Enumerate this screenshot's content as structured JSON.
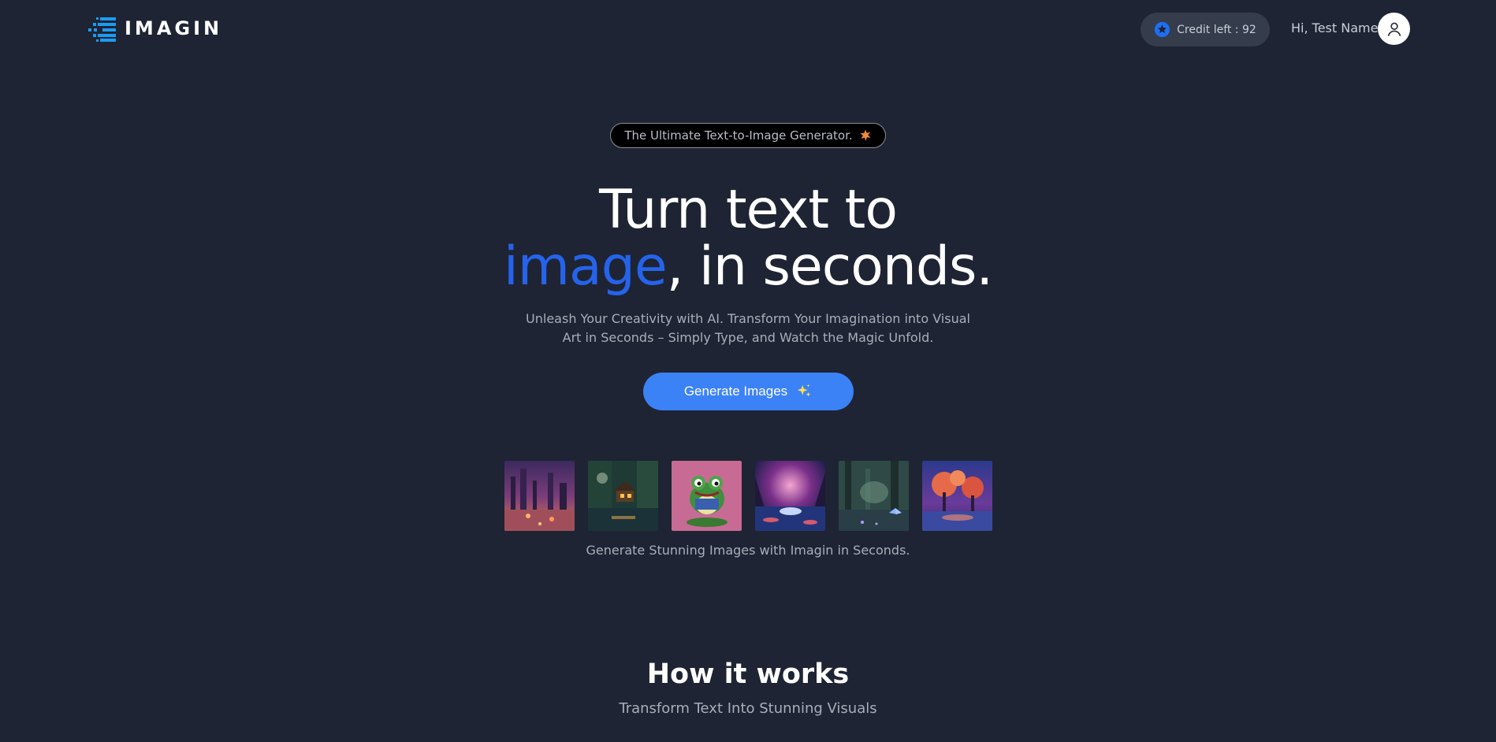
{
  "header": {
    "logo_text": "IMAGIN",
    "credits_label": "Credit left : 92",
    "greeting": "Hi, Test Name"
  },
  "hero": {
    "tagline": "The Ultimate Text-to-Image Generator.",
    "headline_line1": "Turn text to",
    "headline_accent": "image",
    "headline_rest": ", in seconds.",
    "subtitle": "Unleash Your Creativity with AI. Transform Your Imagination into Visual Art in Seconds – Simply Type, and Watch the Magic Unfold.",
    "cta_label": "Generate Images"
  },
  "gallery": {
    "caption": "Generate Stunning Images with Imagin in Seconds.",
    "images": [
      "neon-city-image",
      "forest-cottage-image",
      "frog-image",
      "glowing-lake-image",
      "fairy-forest-image",
      "sunset-trees-image"
    ]
  },
  "how_it_works": {
    "title": "How it works",
    "subtitle": "Transform Text Into Stunning Visuals"
  },
  "colors": {
    "background": "#1e2433",
    "accent": "#2563eb",
    "button": "#3b82f6",
    "credits_bg": "#353c4b"
  }
}
